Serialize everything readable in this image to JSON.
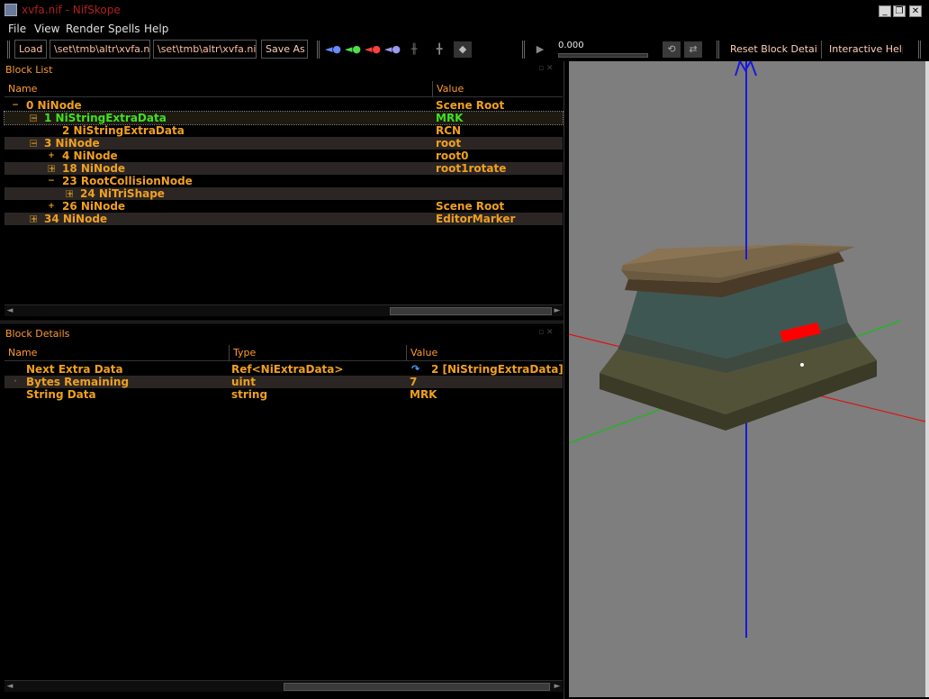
{
  "window": {
    "title": "xvfa.nif - NifSkope",
    "controls": [
      "_",
      "❐",
      "✕"
    ]
  },
  "menu": [
    "File",
    "View",
    "Render",
    "Spells",
    "Help"
  ],
  "toolbar": {
    "load_label": "Load",
    "load_path": "\\set\\tmb\\altr\\xvfa.nif",
    "save_path": "\\set\\tmb\\altr\\xvfa.nif",
    "save_as_label": "Save As",
    "anim_time": "0.000",
    "reset_label": "Reset Block Details",
    "help_label": "Interactive Help"
  },
  "block_list": {
    "title": "Block List",
    "columns": [
      "Name",
      "Value"
    ],
    "rows": [
      {
        "name": "0 NiNode",
        "value": "Scene Root"
      },
      {
        "name": "1 NiStringExtraData",
        "value": "MRK"
      },
      {
        "name": "2 NiStringExtraData",
        "value": "RCN"
      },
      {
        "name": "3 NiNode",
        "value": "root"
      },
      {
        "name": "4 NiNode",
        "value": "root0"
      },
      {
        "name": "18 NiNode",
        "value": "root1rotate"
      },
      {
        "name": "23 RootCollisionNode",
        "value": ""
      },
      {
        "name": "24 NiTriShape",
        "value": ""
      },
      {
        "name": "26 NiNode",
        "value": "Scene Root"
      },
      {
        "name": "34 NiNode",
        "value": "EditorMarker"
      }
    ]
  },
  "block_details": {
    "title": "Block Details",
    "columns": [
      "Name",
      "Type",
      "Value"
    ],
    "rows": [
      {
        "name": "Next Extra Data",
        "type": "Ref<NiExtraData>",
        "value": "2 [NiStringExtraData]"
      },
      {
        "name": "Bytes Remaining",
        "type": "uint",
        "value": "7"
      },
      {
        "name": "String Data",
        "type": "string",
        "value": "MRK"
      }
    ]
  },
  "colors": {
    "text": "#f0a020",
    "selected_text": "#40e020",
    "title": "#b02020",
    "viewport_bg": "#7e7e7e",
    "axis_x": "#e01010",
    "axis_y": "#10c010",
    "axis_z": "#1010e0"
  }
}
